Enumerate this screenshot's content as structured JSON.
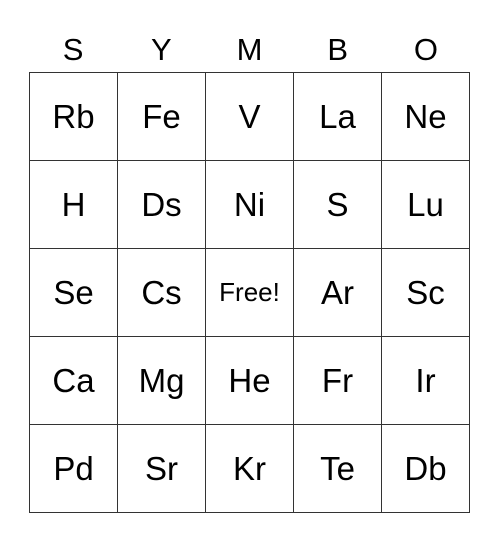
{
  "header": [
    "S",
    "Y",
    "M",
    "B",
    "O"
  ],
  "cells": [
    [
      "Rb",
      "Fe",
      "V",
      "La",
      "Ne"
    ],
    [
      "H",
      "Ds",
      "Ni",
      "S",
      "Lu"
    ],
    [
      "Se",
      "Cs",
      "Free!",
      "Ar",
      "Sc"
    ],
    [
      "Ca",
      "Mg",
      "He",
      "Fr",
      "Ir"
    ],
    [
      "Pd",
      "Sr",
      "Kr",
      "Te",
      "Db"
    ]
  ]
}
